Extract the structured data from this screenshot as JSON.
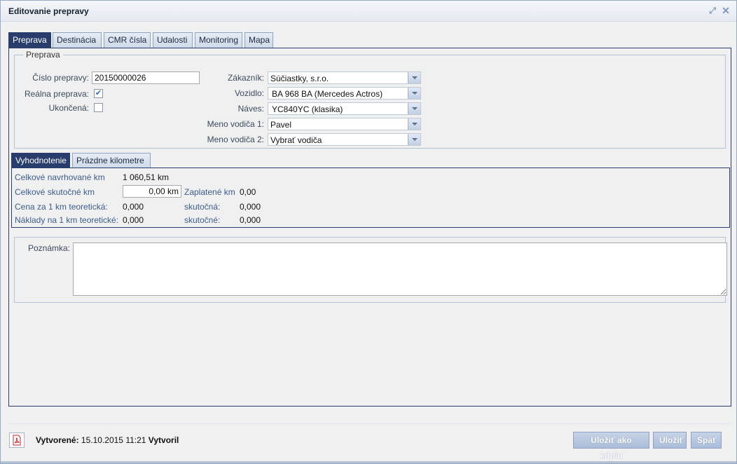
{
  "window": {
    "title": "Editovanie prepravy"
  },
  "tabs": [
    "Preprava",
    "Destinácia",
    "CMR čísla",
    "Udalosti",
    "Monitoring",
    "Mapa"
  ],
  "preprava": {
    "legend": "Preprava",
    "cislo_label": "Číslo prepravy:",
    "cislo_value": "20150000026",
    "realna_label": "Reálna preprava:",
    "realna_checked": true,
    "ukoncena_label": "Ukončená:",
    "ukoncena_checked": false,
    "zakaznik_label": "Zákazník:",
    "zakaznik_value": "Súčiastky, s.r.o.",
    "vozidlo_label": "Vozidlo:",
    "vozidlo_value": "BA 968 BA (Mercedes Actros)",
    "naves_label": "Náves:",
    "naves_value": "YC840YC (klasika)",
    "vodic1_label": "Meno vodiča 1:",
    "vodic1_value": "Pavel",
    "vodic2_label": "Meno vodiča 2:",
    "vodic2_value": "Vybrať vodiča"
  },
  "subtabs": [
    "Vyhodnotenie",
    "Prázdne kilometre"
  ],
  "vyhodnotenie": {
    "navrhovane_label": "Celkové navrhované km",
    "navrhovane_value": "1 060,51 km",
    "skutocne_label": "Celkové skutočné km",
    "skutocne_value": "0,00 km",
    "zaplatene_label": "Zaplatené km",
    "zaplatene_value": "0,00",
    "cena_label": "Cena za 1 km teoretická:",
    "cena_value": "0,000",
    "cena_skut_label": "skutočná:",
    "cena_skut_value": "0,000",
    "naklady_label": "Náklady na 1 km teoretické:",
    "naklady_value": "0,000",
    "naklady_skut_label": "skutočné:",
    "naklady_skut_value": "0,000"
  },
  "note": {
    "label": "Poznámka:",
    "value": ""
  },
  "footer": {
    "created_label": "Vytvorené:",
    "created_value": "15.10.2015 11:21",
    "created_by_label": "Vytvoril",
    "save_copy": "Uložiť ako kópiu",
    "save": "Uložiť",
    "back": "Späť"
  },
  "colors": {
    "active_tab": "#283d6b",
    "button": "#aabdd9",
    "pdf_icon": "#c8262c"
  }
}
